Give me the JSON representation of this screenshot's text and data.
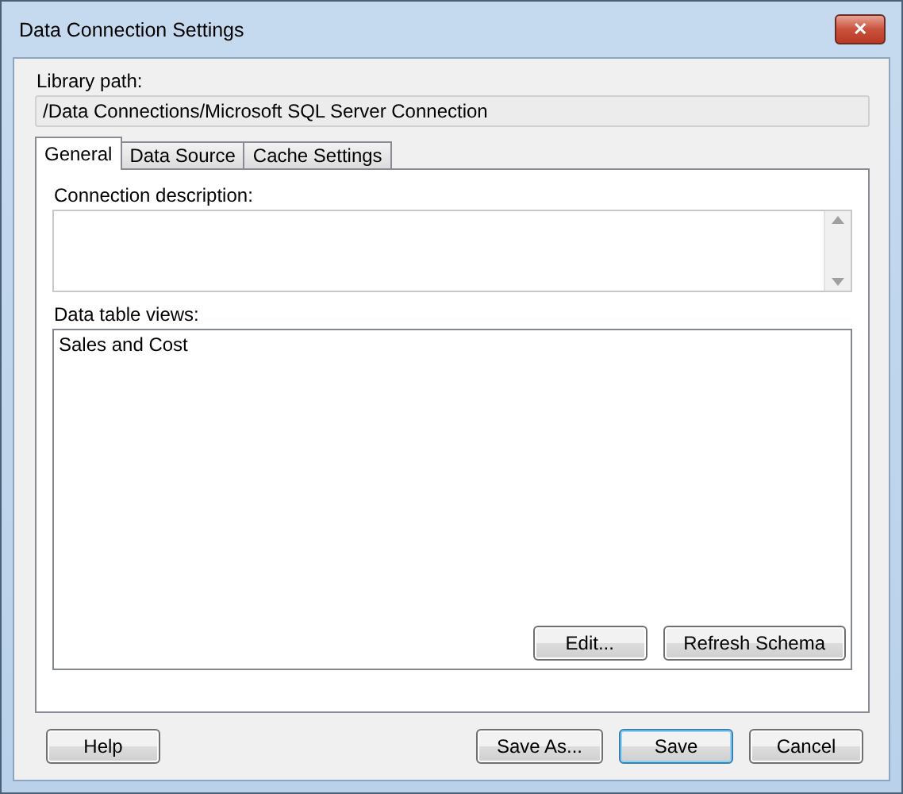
{
  "window": {
    "title": "Data Connection Settings",
    "close": "✕"
  },
  "library_path": {
    "label": "Library path:",
    "value": "/Data Connections/Microsoft SQL Server Connection"
  },
  "tabs": [
    {
      "label": "General",
      "selected": true
    },
    {
      "label": "Data Source",
      "selected": false
    },
    {
      "label": "Cache Settings",
      "selected": false
    }
  ],
  "general": {
    "description_label": "Connection description:",
    "views_label": "Data table views:",
    "views": [
      "Sales and Cost"
    ],
    "buttons": [
      {
        "label": "Edit...",
        "default": false
      },
      {
        "label": "Refresh Schema",
        "default": false
      }
    ]
  },
  "footer": {
    "left": [
      {
        "label": "Help",
        "default": false
      }
    ],
    "right": [
      {
        "label": "Save As...",
        "default": false
      },
      {
        "label": "Save",
        "default": true
      },
      {
        "label": "Cancel",
        "default": false
      }
    ]
  }
}
